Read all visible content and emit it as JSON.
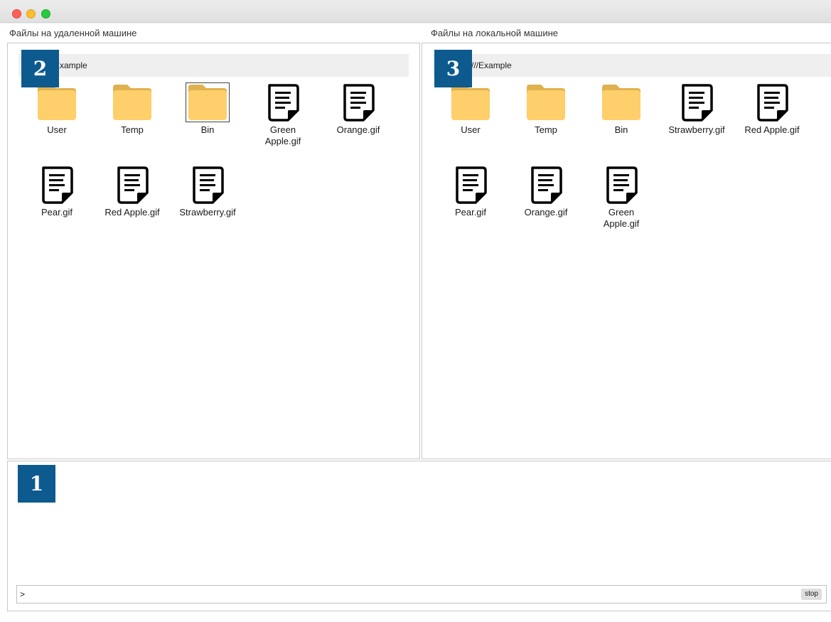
{
  "labels": {
    "remote": "Файлы на удаленной машине",
    "local": "Файлы на локальной машине"
  },
  "remote": {
    "path": "Example",
    "items": [
      {
        "name": "User",
        "type": "folder"
      },
      {
        "name": "Temp",
        "type": "folder"
      },
      {
        "name": "Bin",
        "type": "folder"
      },
      {
        "name": "Green Apple.gif",
        "type": "file"
      },
      {
        "name": "Orange.gif",
        "type": "file"
      },
      {
        "name": "Pear.gif",
        "type": "file"
      },
      {
        "name": "Red Apple.gif",
        "type": "file"
      },
      {
        "name": "Strawberry.gif",
        "type": "file"
      }
    ]
  },
  "local": {
    "path": "e:///Example",
    "items": [
      {
        "name": "User",
        "type": "folder"
      },
      {
        "name": "Temp",
        "type": "folder"
      },
      {
        "name": "Bin",
        "type": "folder"
      },
      {
        "name": "Strawberry.gif",
        "type": "file"
      },
      {
        "name": "Red Apple.gif",
        "type": "file"
      },
      {
        "name": "Pear.gif",
        "type": "file"
      },
      {
        "name": "Orange.gif",
        "type": "file"
      },
      {
        "name": "Green Apple.gif",
        "type": "file"
      }
    ]
  },
  "badges": {
    "one": "1",
    "two": "2",
    "three": "3"
  },
  "console": {
    "prompt": ">",
    "stop_label": "stop"
  },
  "icons": {
    "folder": "folder-icon",
    "file": "document-icon"
  },
  "colors": {
    "badge": "#0d5a8f",
    "folder": "#fecf6a"
  }
}
